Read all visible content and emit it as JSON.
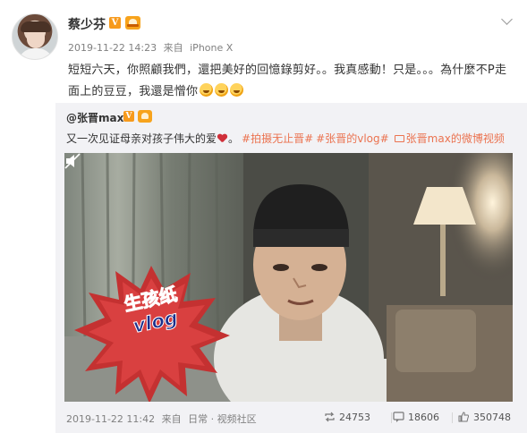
{
  "post": {
    "username": "蔡少芬",
    "v_badge": "V",
    "timestamp": "2019-11-22 14:23",
    "source_prefix": "来自",
    "source": "iPhone X",
    "text": "短短六天，你照顧我們，還把美好的回憶錄剪好。。我真感動！只是。。。為什麼不P走面上的豆豆，我還是憎你",
    "emoji_count": 3
  },
  "repost": {
    "username": "@张晋max",
    "v_badge": "V",
    "text": "又一次见证母亲对孩子伟大的爱",
    "tag1": "#拍摄无止晋#",
    "tag2": "#张晋的vlog#",
    "video_link": "张晋max的微博视频",
    "sticker_line1": "生孩纸",
    "sticker_line2": "vlog",
    "timestamp": "2019-11-22 11:42",
    "source_prefix": "来自",
    "source": "日常 · 视频社区",
    "reposts": "24753",
    "comments": "18606",
    "likes": "350748"
  },
  "colors": {
    "link": "#eb7350",
    "verified": "#f79a1c",
    "heart": "#d0303a",
    "meta": "#808080"
  },
  "icons": [
    "chevron-down-icon",
    "verified-icon",
    "level-crown-icon",
    "laugh-emoji-icon",
    "heart-emoji-icon",
    "video-link-icon",
    "mute-icon",
    "repost-icon",
    "comment-icon",
    "like-icon"
  ]
}
